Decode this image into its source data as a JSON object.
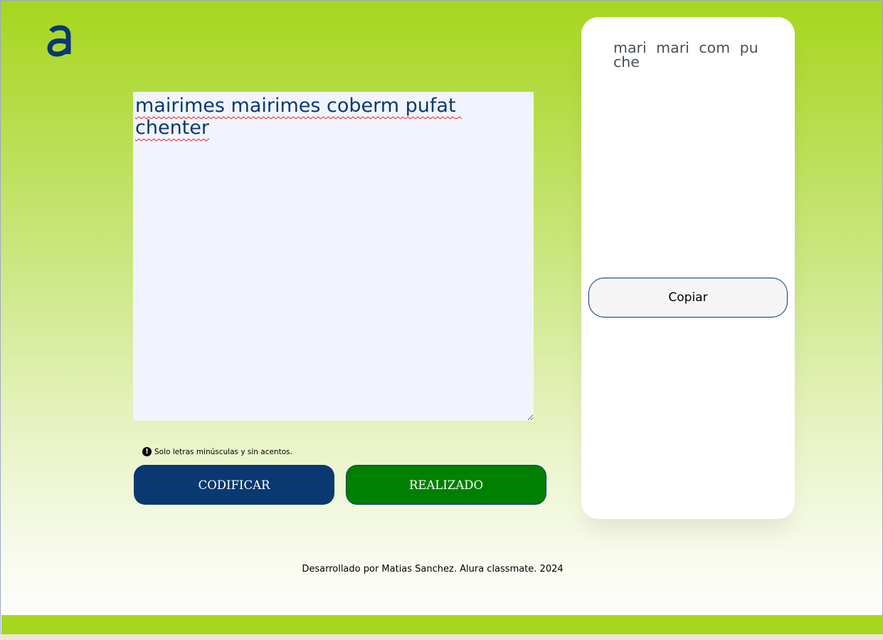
{
  "logo": {
    "icon": "alura-logo-icon",
    "color": "#0a3871"
  },
  "input": {
    "value": "mairimes mairimes coberm pufat chenter"
  },
  "hint": {
    "icon": "exclamation-circle-icon",
    "text": "Solo letras minúsculas y sin acentos."
  },
  "buttons": {
    "encode_label": "CODIFICAR",
    "done_label": "REALIZADO"
  },
  "output": {
    "text": "mari mari com pu che",
    "copy_label": "Copiar"
  },
  "footer": {
    "text": "Desarrollado por Matias Sanchez. Alura classmate. 2024"
  },
  "colors": {
    "accent_navy": "#0a3871",
    "done_green": "#008000",
    "lime": "#a6d61e"
  }
}
